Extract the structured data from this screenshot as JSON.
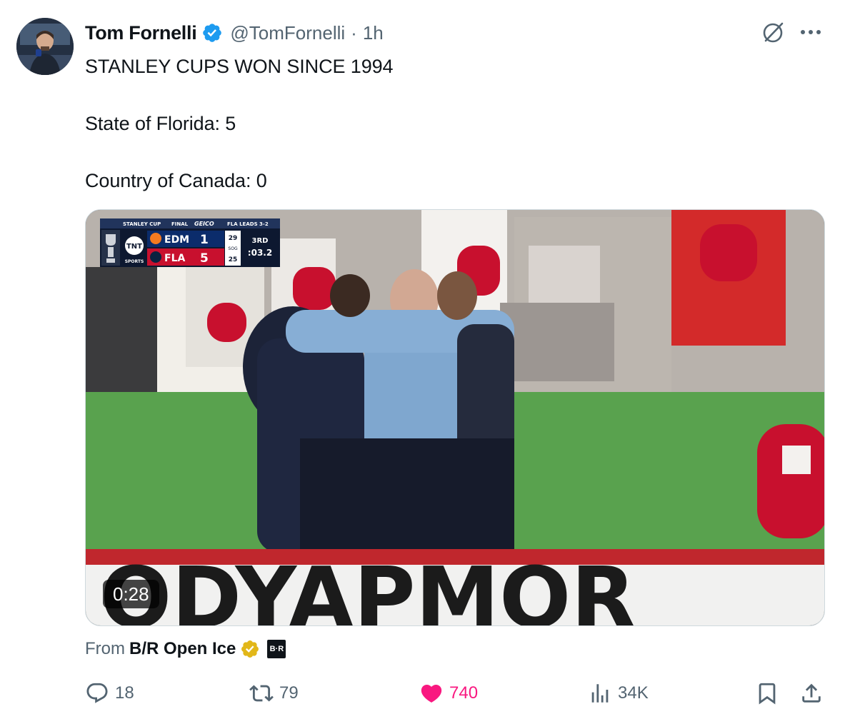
{
  "author": {
    "name": "Tom Fornelli",
    "handle": "@TomFornelli",
    "separator": "·",
    "time": "1h"
  },
  "tweet": {
    "text": "STANLEY CUPS WON SINCE 1994\n\nState of Florida: 5\n\nCountry of Canada: 0"
  },
  "media": {
    "duration": "0:28",
    "scorebug": {
      "series": "STANLEY CUP",
      "round": "FINAL",
      "sponsor": "GEICO",
      "status": "FLA LEADS 3-2",
      "network": "TNT",
      "network_sub": "SPORTS",
      "teams": [
        {
          "abbr": "EDM",
          "score": "1",
          "sog": "29"
        },
        {
          "abbr": "FLA",
          "score": "5",
          "sog": "25"
        }
      ],
      "sog_label": "SOG",
      "period": "3RD",
      "clock": ":03.2"
    },
    "board_text": "ODYAPMOR"
  },
  "source": {
    "prefix": "From",
    "name": "B/R Open Ice",
    "badge": "B·R"
  },
  "actions": {
    "replies": "18",
    "reposts": "79",
    "likes": "740",
    "views": "34K"
  },
  "icons": {
    "verified": "verified-blue-badge-icon",
    "org_verified": "verified-gold-badge-icon",
    "grok": "grok-icon",
    "more": "more-dots-icon",
    "reply": "reply-icon",
    "repost": "repost-icon",
    "like": "heart-icon",
    "views": "views-chart-icon",
    "bookmark": "bookmark-icon",
    "share": "share-icon"
  },
  "colors": {
    "accent_blue": "#1d9bf0",
    "like_pink": "#f91880",
    "muted": "#536471",
    "text": "#0f1419",
    "gold": "#e2b719"
  }
}
